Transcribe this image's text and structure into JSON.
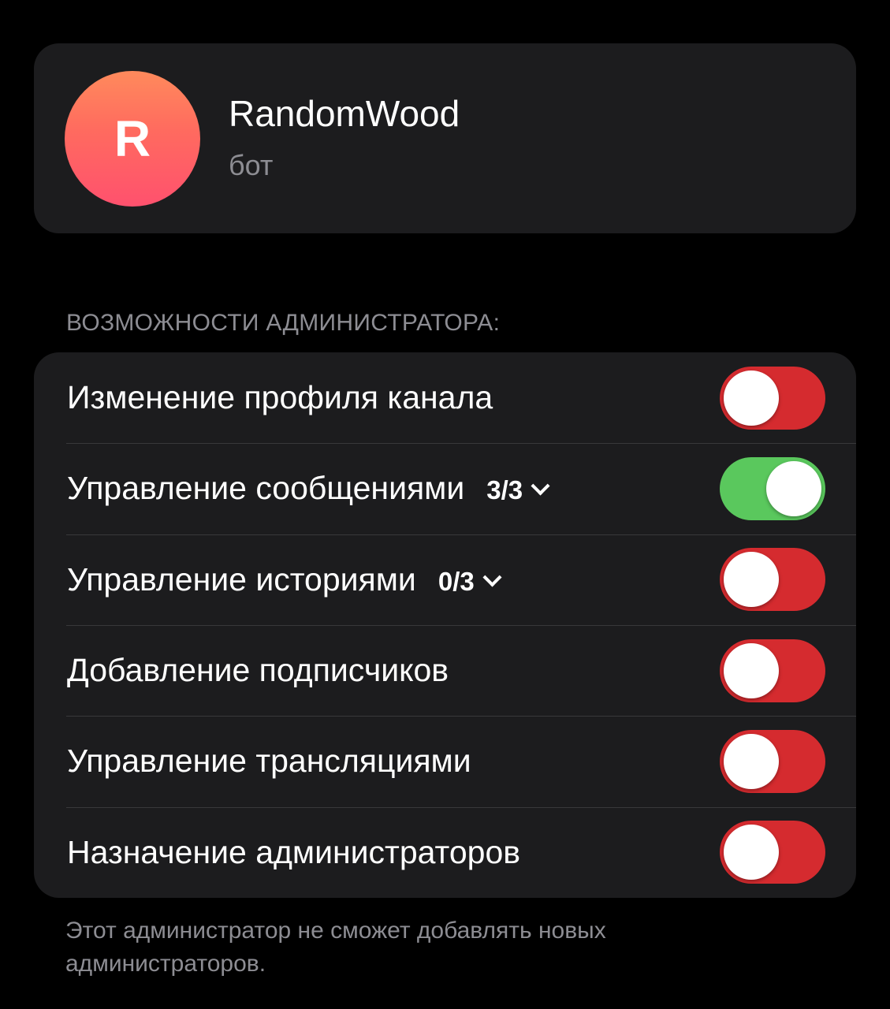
{
  "profile": {
    "avatar_letter": "R",
    "name": "RandomWood",
    "status": "бот"
  },
  "rights": {
    "header": "ВОЗМОЖНОСТИ АДМИНИСТРАТОРА:",
    "items": [
      {
        "label": "Изменение профиля канала",
        "count": "",
        "enabled": false
      },
      {
        "label": "Управление сообщениями",
        "count": "3/3",
        "enabled": true
      },
      {
        "label": "Управление историями",
        "count": "0/3",
        "enabled": false
      },
      {
        "label": "Добавление подписчиков",
        "count": "",
        "enabled": false
      },
      {
        "label": "Управление трансляциями",
        "count": "",
        "enabled": false
      },
      {
        "label": "Назначение администраторов",
        "count": "",
        "enabled": false
      }
    ],
    "footer": "Этот администратор не сможет добавлять новых администраторов."
  },
  "colors": {
    "background": "#000000",
    "card": "#1c1c1e",
    "toggle_off": "#d52b2f",
    "toggle_on": "#5ac85d",
    "secondary_text": "#8d8d93"
  },
  "icons": {
    "expand": "chevron-down-icon"
  }
}
